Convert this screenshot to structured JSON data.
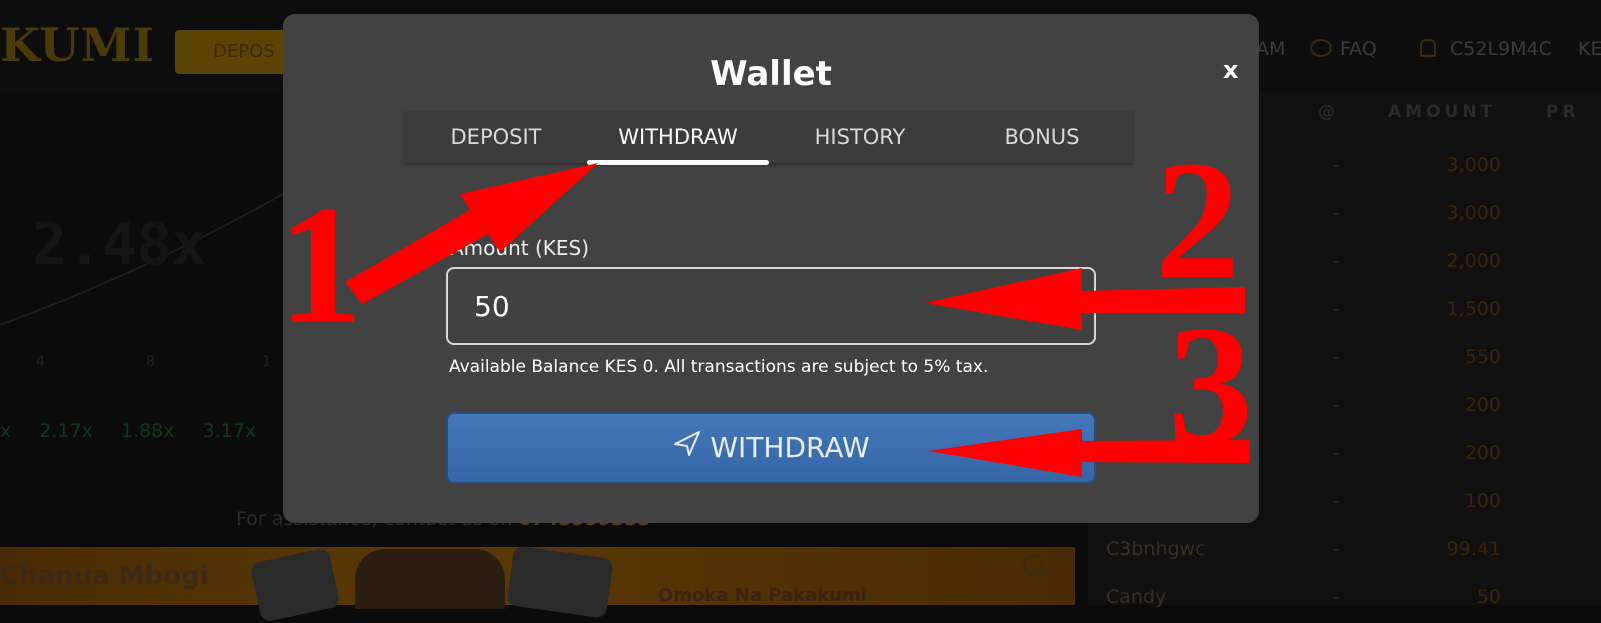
{
  "background": {
    "logo": "KUMI",
    "deposit_button": "DEPOS",
    "nav": {
      "am": "AM",
      "faq": "FAQ",
      "user": "C52L9M4C",
      "ke": "KE"
    },
    "multiplier": "2.48x",
    "history": [
      "x",
      "2.17x",
      "1.88x",
      "3.17x"
    ],
    "axis": [
      "4",
      "8",
      "1"
    ],
    "assistance_text": "For assistance, contact us on",
    "assistance_phone": "0743999333",
    "banner_left": "Chanua Mbogi",
    "banner_right": "Omoka Na Pakakumi",
    "right_panel": {
      "headers": {
        "at": "@",
        "amount": "AMOUNT",
        "pr": "PR"
      },
      "rows": [
        {
          "name": "",
          "dash": "-",
          "amount": "3,000"
        },
        {
          "name": "",
          "dash": "-",
          "amount": "3,000"
        },
        {
          "name": "",
          "dash": "-",
          "amount": "2,000"
        },
        {
          "name": "",
          "dash": "-",
          "amount": "1,500"
        },
        {
          "name": "",
          "dash": "-",
          "amount": "550"
        },
        {
          "name": "",
          "dash": "-",
          "amount": "200"
        },
        {
          "name": "",
          "dash": "-",
          "amount": "200"
        },
        {
          "name": "",
          "dash": "-",
          "amount": "100"
        },
        {
          "name": "C3bnhgwc",
          "dash": "-",
          "amount": "99.41"
        },
        {
          "name": "Candy",
          "dash": "-",
          "amount": "50"
        }
      ]
    }
  },
  "modal": {
    "title": "Wallet",
    "close_label": "x",
    "tabs": [
      {
        "label": "DEPOSIT"
      },
      {
        "label": "WITHDRAW"
      },
      {
        "label": "HISTORY"
      },
      {
        "label": "BONUS"
      }
    ],
    "active_tab": "WITHDRAW",
    "amount_label": "Amount (KES)",
    "amount_value": "50",
    "balance_note": "Available Balance KES 0. All transactions are subject to 5% tax.",
    "withdraw_button": "WITHDRAW"
  },
  "annotations": {
    "n1": "1",
    "n2": "2",
    "n3": "3",
    "color": "#ff0000"
  },
  "colors": {
    "modal_bg": "#424242",
    "button_blue": "#3d6fb0",
    "accent_gold": "#c8900e"
  }
}
